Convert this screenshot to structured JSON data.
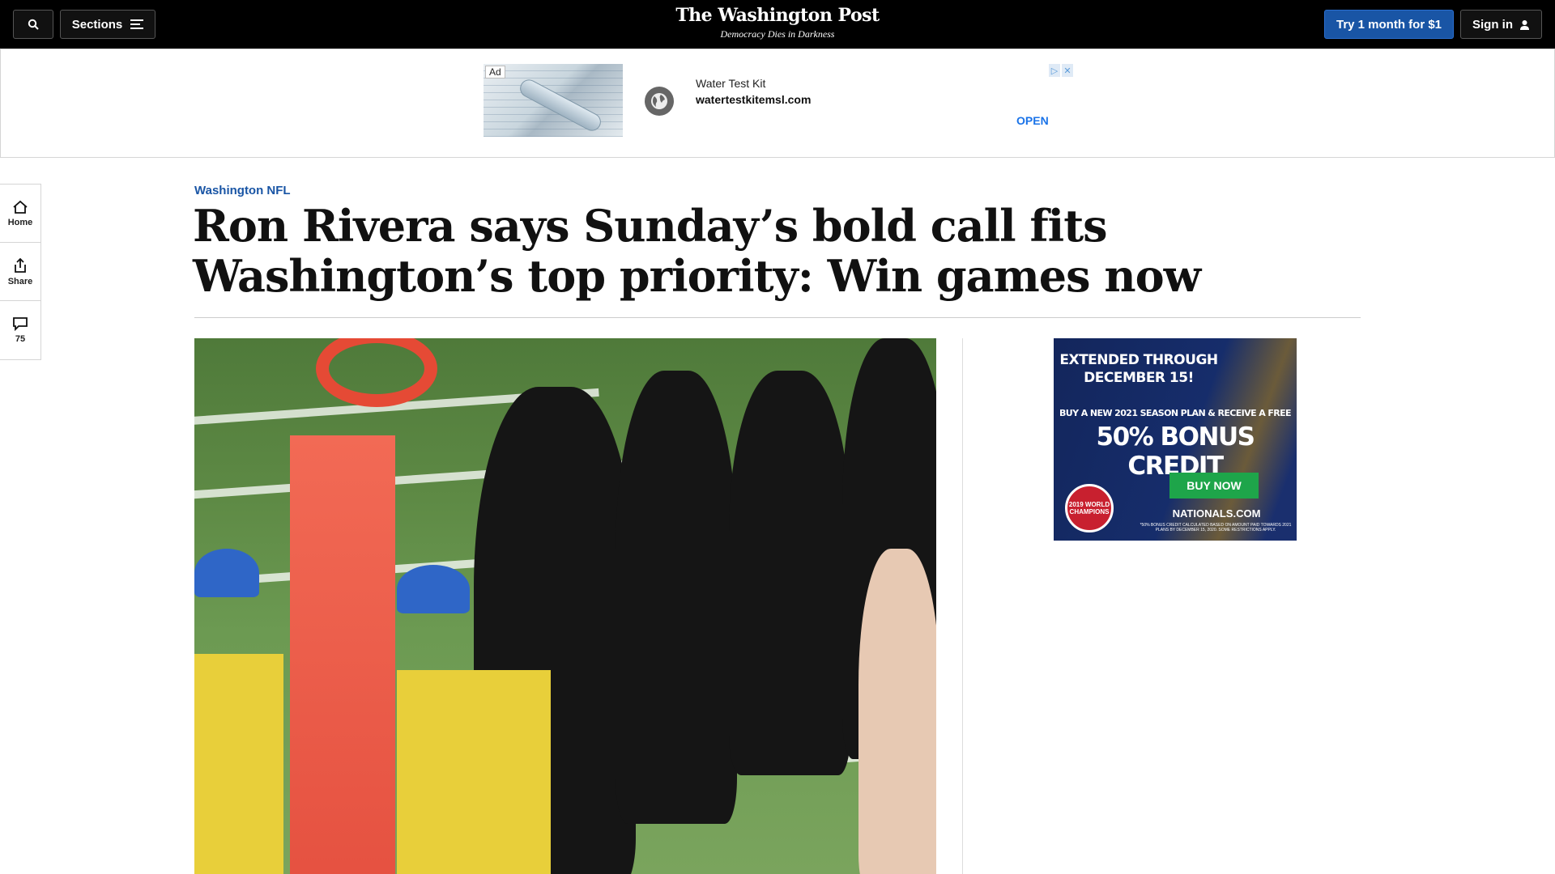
{
  "nav": {
    "sections_label": "Sections",
    "logo_name": "The Washington Post",
    "logo_tagline": "Democracy Dies in Darkness",
    "try_label": "Try 1 month for $1",
    "signin_label": "Sign in"
  },
  "ad_banner": {
    "ad_label": "Ad",
    "title": "Water Test Kit",
    "url": "watertestkitemsl.com",
    "open_label": "OPEN"
  },
  "rail": {
    "home_label": "Home",
    "share_label": "Share",
    "comments_count": "75"
  },
  "article": {
    "kicker": "Washington NFL",
    "headline": "Ron Rivera says Sunday’s bold call fits Washington’s top priority: Win games now"
  },
  "side_ad": {
    "line1": "EXTENDED THROUGH DECEMBER 15!",
    "line2": "BUY A NEW 2021 SEASON PLAN & RECEIVE A FREE",
    "line3": "50% BONUS CREDIT",
    "button": "BUY NOW",
    "site": "NATIONALS.COM",
    "badge": "2019 WORLD CHAMPIONS",
    "fine_print": "*50% BONUS CREDIT CALCULATED BASED ON AMOUNT PAID TOWARDS 2021 PLANS BY DECEMBER 15, 2020. SOME RESTRICTIONS APPLY."
  }
}
